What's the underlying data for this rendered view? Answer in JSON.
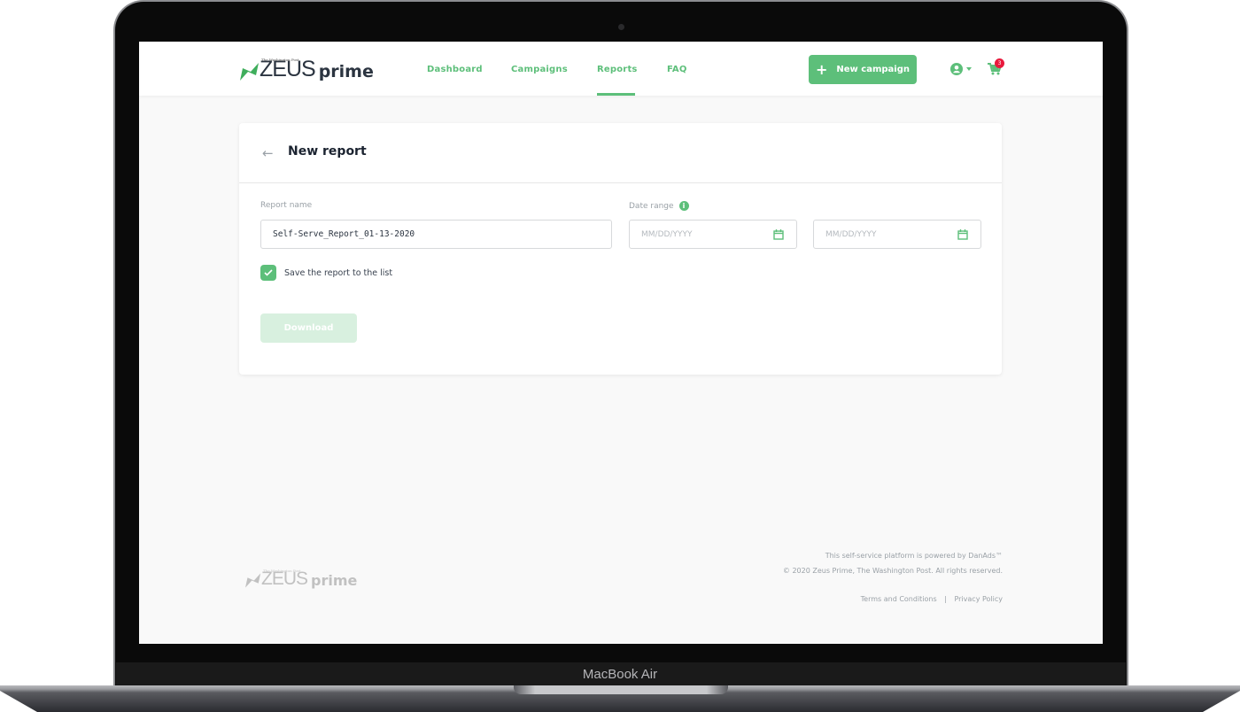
{
  "device": {
    "label": "MacBook Air"
  },
  "header": {
    "logo": {
      "tagline": "The Washington Post",
      "brand": "ZEUS",
      "sub": "prime"
    },
    "nav": [
      {
        "label": "Dashboard",
        "active": false
      },
      {
        "label": "Campaigns",
        "active": false
      },
      {
        "label": "Reports",
        "active": true
      },
      {
        "label": "FAQ",
        "active": false
      }
    ],
    "new_campaign_label": "New campaign",
    "user_icon": "user-circle-icon",
    "cart_icon": "cart-icon",
    "cart_count": "3"
  },
  "card": {
    "back_icon": "arrow-left-icon",
    "title": "New report",
    "report_name_label": "Report name",
    "report_name_value": "Self-Serve_Report_01-13-2020",
    "date_range_label": "Date range",
    "date_start_placeholder": "MM/DD/YYYY",
    "date_end_placeholder": "MM/DD/YYYY",
    "save_checkbox_label": "Save the report to the list",
    "save_checked": true,
    "download_label": "Download"
  },
  "footer": {
    "logo": {
      "tagline": "The Washington Post",
      "brand": "ZEUS",
      "sub": "prime"
    },
    "powered_by": "This self-service platform is powered by DanAds™",
    "copyright": "© 2020 Zeus Prime, The Washington Post. All rights reserved.",
    "terms": "Terms and Conditions",
    "separator": "|",
    "privacy": "Privacy Policy"
  },
  "colors": {
    "accent": "#5dbf7a",
    "badge": "#e8193c",
    "disabled": "#d8f0df"
  }
}
